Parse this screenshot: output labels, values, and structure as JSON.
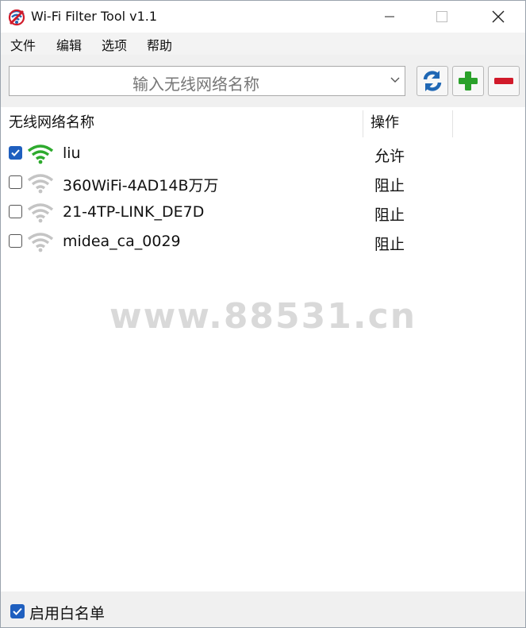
{
  "window": {
    "title": "Wi-Fi Filter Tool v1.1"
  },
  "menu": [
    "文件",
    "编辑",
    "选项",
    "帮助"
  ],
  "toolbar": {
    "network_placeholder": "输入无线网络名称",
    "buttons": [
      {
        "name": "refresh",
        "icon": "refresh-icon",
        "color": "#1f67b4"
      },
      {
        "name": "add",
        "icon": "plus-icon",
        "color": "#2aa12a"
      },
      {
        "name": "remove",
        "icon": "minus-icon",
        "color": "#d11a2a"
      }
    ]
  },
  "list": {
    "columns": [
      "无线网络名称",
      "操作"
    ],
    "rows": [
      {
        "checked": true,
        "name": "liu",
        "action": "允许",
        "signal_color": "#2eaa2e"
      },
      {
        "checked": false,
        "name": "360WiFi-4AD14B万万",
        "action": "阻止",
        "signal_color": "#c4c4c4"
      },
      {
        "checked": false,
        "name": "21-4TP-LINK_DE7D",
        "action": "阻止",
        "signal_color": "#c4c4c4"
      },
      {
        "checked": false,
        "name": "midea_ca_0029",
        "action": "阻止",
        "signal_color": "#c4c4c4"
      }
    ]
  },
  "watermark": "www.88531.cn",
  "status": {
    "whitelist_label": "启用白名单",
    "whitelist_checked": true
  }
}
